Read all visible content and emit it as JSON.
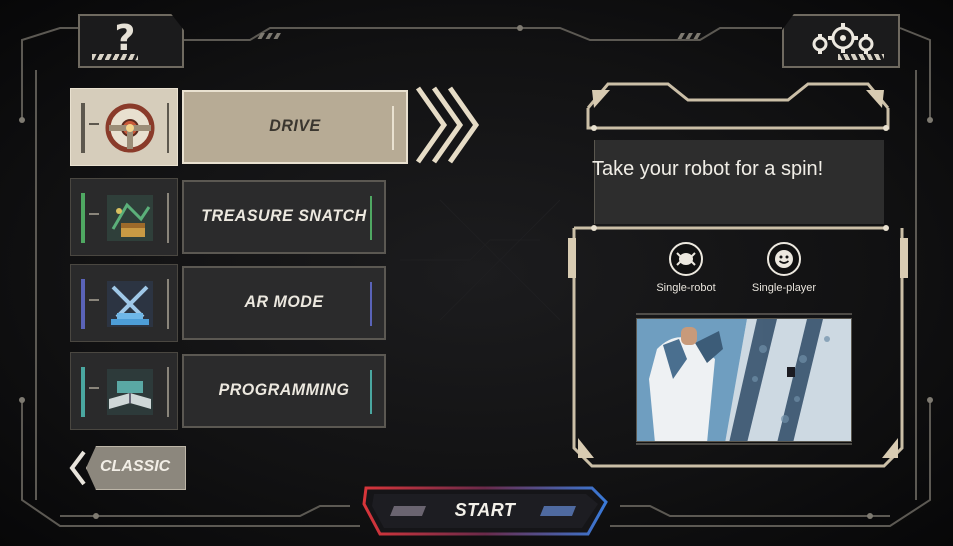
{
  "header": {
    "help_label": "?",
    "help_icon": "question-mark-icon",
    "settings_icon": "gear-cluster-icon"
  },
  "modes": [
    {
      "label": "DRIVE",
      "icon": "steering-wheel-icon",
      "selected": true,
      "accent": "#5d584e"
    },
    {
      "label": "TREASURE SNATCH",
      "icon": "treasure-map-icon",
      "selected": false,
      "accent": "#4fa862"
    },
    {
      "label": "AR MODE",
      "icon": "crossed-swords-icon",
      "selected": false,
      "accent": "#5a63b8"
    },
    {
      "label": "PROGRAMMING",
      "icon": "open-book-icon",
      "selected": false,
      "accent": "#4aa7a0"
    }
  ],
  "classic_button": {
    "label": "CLASSIC"
  },
  "start_button": {
    "label": "START"
  },
  "info_panel": {
    "description": "Take your robot for a spin!",
    "features": [
      {
        "label": "Single-robot",
        "icon": "robot-icon"
      },
      {
        "label": "Single-player",
        "icon": "smiley-face-icon"
      }
    ]
  },
  "colors": {
    "accent_beige": "#b7ab95",
    "start_red": "#d8353a",
    "start_blue": "#3a7ad8"
  }
}
